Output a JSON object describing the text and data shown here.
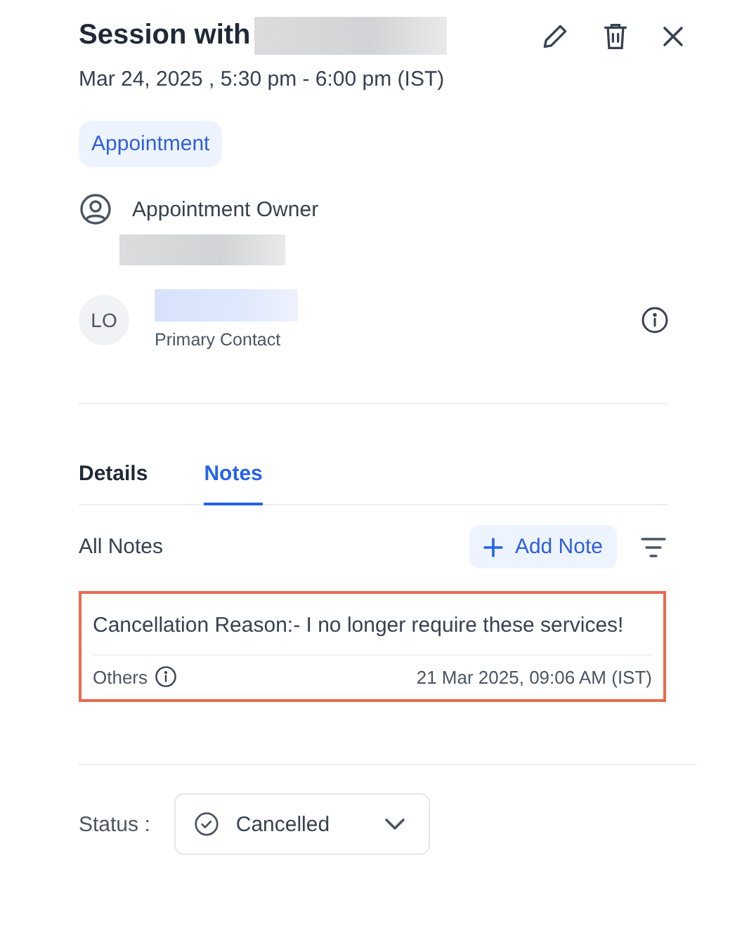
{
  "header": {
    "title": "Session with",
    "datetime": "Mar 24, 2025 , 5:30 pm - 6:00 pm (IST)"
  },
  "tag": "Appointment",
  "owner": {
    "label": "Appointment Owner"
  },
  "contact": {
    "initials": "LO",
    "role": "Primary Contact"
  },
  "tabs": [
    {
      "label": "Details",
      "selected": false
    },
    {
      "label": "Notes",
      "selected": true
    }
  ],
  "notes_header": {
    "title": "All Notes",
    "add_button": "Add Note"
  },
  "notes": [
    {
      "text": "Cancellation Reason:- I no longer require these services!",
      "category": "Others",
      "timestamp": "21 Mar 2025, 09:06 AM (IST)",
      "highlighted": true
    }
  ],
  "status": {
    "label": "Status :",
    "value": "Cancelled"
  }
}
